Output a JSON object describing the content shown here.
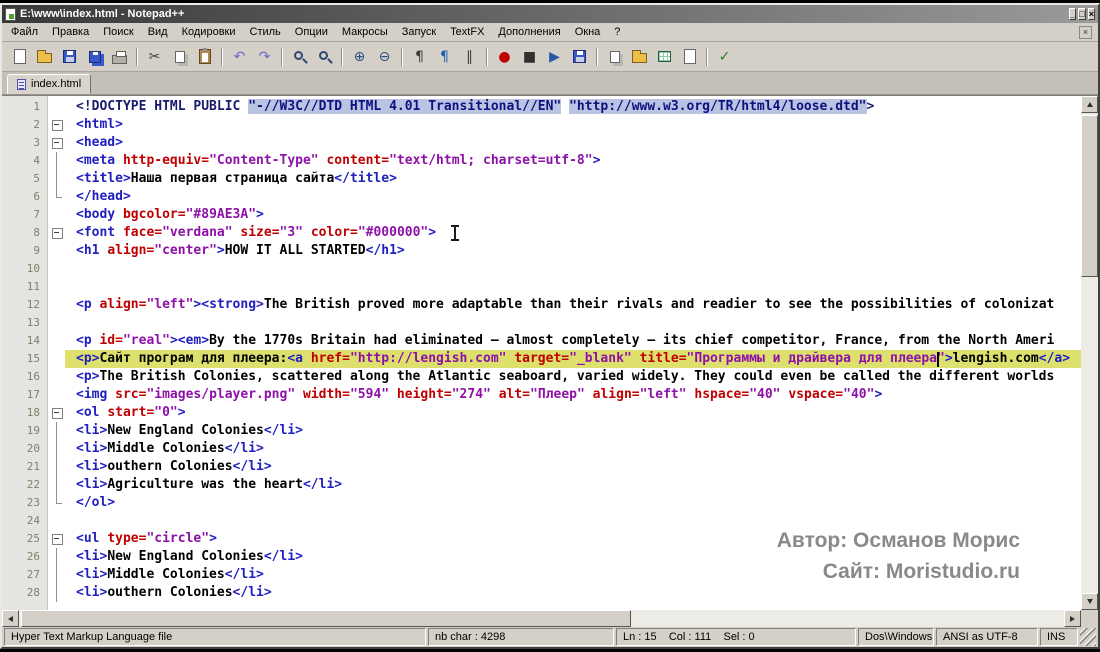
{
  "window": {
    "title": "E:\\www\\index.html - Notepad++",
    "controls": [
      {
        "name": "minimize",
        "glyph": "_"
      },
      {
        "name": "maximize",
        "glyph": "□"
      },
      {
        "name": "close",
        "glyph": "×"
      }
    ]
  },
  "menu": {
    "close_glyph": "×",
    "items": [
      {
        "name": "menu-file",
        "label": "Файл"
      },
      {
        "name": "menu-edit",
        "label": "Правка"
      },
      {
        "name": "menu-search",
        "label": "Поиск"
      },
      {
        "name": "menu-view",
        "label": "Вид"
      },
      {
        "name": "menu-encodings",
        "label": "Кодировки"
      },
      {
        "name": "menu-style",
        "label": "Стиль"
      },
      {
        "name": "menu-settings",
        "label": "Опции"
      },
      {
        "name": "menu-macros",
        "label": "Макросы"
      },
      {
        "name": "menu-run",
        "label": "Запуск"
      },
      {
        "name": "menu-textfx",
        "label": "TextFX"
      },
      {
        "name": "menu-plugins",
        "label": "Дополнения"
      },
      {
        "name": "menu-windows",
        "label": "Окна"
      },
      {
        "name": "menu-help",
        "label": "?"
      }
    ]
  },
  "toolbar": {
    "icons": [
      {
        "name": "new-file",
        "kind": "page"
      },
      {
        "name": "open-file",
        "kind": "folder"
      },
      {
        "name": "save",
        "kind": "floppy"
      },
      {
        "name": "save-all",
        "kind": "floppy2"
      },
      {
        "name": "print",
        "kind": "printer"
      },
      {
        "sep": true
      },
      {
        "name": "cut",
        "glyph": "✂",
        "color": "#404040"
      },
      {
        "name": "copy",
        "kind": "pages"
      },
      {
        "name": "paste",
        "kind": "clipboard"
      },
      {
        "sep": true
      },
      {
        "name": "undo",
        "glyph": "↶",
        "color": "#6868C8"
      },
      {
        "name": "redo",
        "glyph": "↷",
        "color": "#6868C8"
      },
      {
        "sep": true
      },
      {
        "name": "find",
        "kind": "mag"
      },
      {
        "name": "find-replace",
        "kind": "mag"
      },
      {
        "sep": true
      },
      {
        "name": "zoom-in",
        "glyph": "⊕",
        "color": "#305080"
      },
      {
        "name": "zoom-out",
        "glyph": "⊖",
        "color": "#305080"
      },
      {
        "sep": true
      },
      {
        "name": "word-wrap",
        "glyph": "¶",
        "color": "#404040"
      },
      {
        "name": "show-all-characters",
        "glyph": "¶",
        "color": "#2060A8"
      },
      {
        "name": "indent-guide",
        "glyph": "∥",
        "color": "#404040"
      },
      {
        "sep": true
      },
      {
        "name": "record-macro",
        "glyph": "●",
        "color": "#C00000"
      },
      {
        "name": "stop-macro",
        "glyph": "■",
        "color": "#303030"
      },
      {
        "name": "play-macro",
        "glyph": "▶",
        "color": "#2858A8"
      },
      {
        "name": "save-macro",
        "kind": "floppy"
      },
      {
        "sep": true
      },
      {
        "name": "doc-monitor",
        "kind": "pages"
      },
      {
        "name": "folder-workspace",
        "kind": "folder"
      },
      {
        "name": "function-list",
        "kind": "grid"
      },
      {
        "name": "doc-map",
        "kind": "page"
      },
      {
        "sep": true
      },
      {
        "name": "spell-check",
        "glyph": "✓",
        "color": "#208020"
      }
    ]
  },
  "tabs": [
    {
      "label": "index.html",
      "active": true
    }
  ],
  "editor": {
    "lines": [
      {
        "n": 1,
        "fold": "",
        "seg": [
          [
            "doc",
            "<!DOCTYPE HTML PUBLIC "
          ],
          [
            "docstr",
            "\"-//W3C//DTD HTML 4.01 Transitional//EN\""
          ],
          [
            "doc",
            " "
          ],
          [
            "docstr",
            "\"http://www.w3.org/TR/html4/loose.dtd\""
          ],
          [
            "doc",
            ">"
          ]
        ]
      },
      {
        "n": 2,
        "fold": "box",
        "seg": [
          [
            "tag",
            "<html>"
          ]
        ]
      },
      {
        "n": 3,
        "fold": "box",
        "seg": [
          [
            "tag",
            "<head>"
          ]
        ]
      },
      {
        "n": 4,
        "fold": "line",
        "seg": [
          [
            "tag",
            "<meta "
          ],
          [
            "attr",
            "http-equiv="
          ],
          [
            "val",
            "\"Content-Type\""
          ],
          [
            "attr",
            " content="
          ],
          [
            "val",
            "\"text/html; charset=utf-8\""
          ],
          [
            "tag",
            ">"
          ]
        ]
      },
      {
        "n": 5,
        "fold": "line",
        "seg": [
          [
            "tag",
            "<title>"
          ],
          [
            "txt",
            "Наша первая страница сайта"
          ],
          [
            "tag",
            "</title>"
          ]
        ]
      },
      {
        "n": 6,
        "fold": "end",
        "seg": [
          [
            "tag",
            "</head>"
          ]
        ]
      },
      {
        "n": 7,
        "fold": "",
        "seg": [
          [
            "tag",
            "<body "
          ],
          [
            "attr",
            "bgcolor="
          ],
          [
            "val",
            "\"#89AE3A\""
          ],
          [
            "tag",
            ">"
          ]
        ]
      },
      {
        "n": 8,
        "fold": "box",
        "seg": [
          [
            "tag",
            "<font "
          ],
          [
            "attr",
            "face="
          ],
          [
            "val",
            "\"verdana\""
          ],
          [
            "attr",
            " size="
          ],
          [
            "val",
            "\"3\""
          ],
          [
            "attr",
            " color="
          ],
          [
            "val",
            "\"#000000\""
          ],
          [
            "tag",
            ">"
          ]
        ]
      },
      {
        "n": 9,
        "fold": "",
        "seg": [
          [
            "tag",
            "<h1 "
          ],
          [
            "attr",
            "align="
          ],
          [
            "val",
            "\"center\""
          ],
          [
            "tag",
            ">"
          ],
          [
            "txt",
            "HOW IT ALL STARTED"
          ],
          [
            "tag",
            "</h1>"
          ]
        ]
      },
      {
        "n": 10,
        "fold": "",
        "seg": []
      },
      {
        "n": 11,
        "fold": "",
        "seg": []
      },
      {
        "n": 12,
        "fold": "",
        "seg": [
          [
            "tag",
            "<p "
          ],
          [
            "attr",
            "align="
          ],
          [
            "val",
            "\"left\""
          ],
          [
            "tag",
            "><strong>"
          ],
          [
            "txt",
            "The British proved more adaptable than their rivals and readier to see the possibilities of colonizat"
          ]
        ]
      },
      {
        "n": 13,
        "fold": "",
        "seg": []
      },
      {
        "n": 14,
        "fold": "",
        "seg": [
          [
            "tag",
            "<p "
          ],
          [
            "attr",
            "id="
          ],
          [
            "val",
            "\"real\""
          ],
          [
            "tag",
            "><em>"
          ],
          [
            "txt",
            "By the 1770s Britain had eliminated — almost completely — its chief competitor, France, from the North Ameri"
          ]
        ]
      },
      {
        "n": 15,
        "fold": "",
        "cur": true,
        "seg": [
          [
            "tag",
            "<p>"
          ],
          [
            "txt",
            "Сайт програм для плеера:"
          ],
          [
            "tag",
            "<a "
          ],
          [
            "attr",
            "href="
          ],
          [
            "val",
            "\"http://lengish.com\""
          ],
          [
            "attr",
            " target="
          ],
          [
            "val",
            "\"_blank\""
          ],
          [
            "attr",
            " title="
          ],
          [
            "val",
            "\"Программы и драйвера для плеера\""
          ],
          [
            "tag",
            ">"
          ],
          [
            "txt",
            "lengish.com"
          ],
          [
            "tag",
            "</a>"
          ]
        ]
      },
      {
        "n": 16,
        "fold": "",
        "seg": [
          [
            "tag",
            "<p>"
          ],
          [
            "txt",
            "The British Colonies, scattered along the Atlantic seaboard, varied widely. They could even be called the different worlds"
          ]
        ]
      },
      {
        "n": 17,
        "fold": "",
        "seg": [
          [
            "tag",
            "<img "
          ],
          [
            "attr",
            "src="
          ],
          [
            "val",
            "\"images/player.png\""
          ],
          [
            "attr",
            " width="
          ],
          [
            "val",
            "\"594\""
          ],
          [
            "attr",
            " height="
          ],
          [
            "val",
            "\"274\""
          ],
          [
            "attr",
            " alt="
          ],
          [
            "val",
            "\"Плеер\""
          ],
          [
            "attr",
            " align="
          ],
          [
            "val",
            "\"left\""
          ],
          [
            "attr",
            " hspace="
          ],
          [
            "val",
            "\"40\""
          ],
          [
            "attr",
            " vspace="
          ],
          [
            "val",
            "\"40\""
          ],
          [
            "tag",
            ">"
          ]
        ]
      },
      {
        "n": 18,
        "fold": "box",
        "seg": [
          [
            "tag",
            "<ol "
          ],
          [
            "attr",
            "start="
          ],
          [
            "val",
            "\"0\""
          ],
          [
            "tag",
            ">"
          ]
        ]
      },
      {
        "n": 19,
        "fold": "line",
        "seg": [
          [
            "tag",
            "<li>"
          ],
          [
            "txt",
            "New England Colonies"
          ],
          [
            "tag",
            "</li>"
          ]
        ]
      },
      {
        "n": 20,
        "fold": "line",
        "seg": [
          [
            "tag",
            "<li>"
          ],
          [
            "txt",
            "Middle Colonies"
          ],
          [
            "tag",
            "</li>"
          ]
        ]
      },
      {
        "n": 21,
        "fold": "line",
        "seg": [
          [
            "tag",
            "<li>"
          ],
          [
            "txt",
            "outhern Colonies"
          ],
          [
            "tag",
            "</li>"
          ]
        ]
      },
      {
        "n": 22,
        "fold": "line",
        "seg": [
          [
            "tag",
            "<li>"
          ],
          [
            "txt",
            "Agriculture was the heart"
          ],
          [
            "tag",
            "</li>"
          ]
        ]
      },
      {
        "n": 23,
        "fold": "end",
        "seg": [
          [
            "tag",
            "</ol>"
          ]
        ]
      },
      {
        "n": 24,
        "fold": "",
        "seg": []
      },
      {
        "n": 25,
        "fold": "box",
        "seg": [
          [
            "tag",
            "<ul "
          ],
          [
            "attr",
            "type="
          ],
          [
            "val",
            "\"circle\""
          ],
          [
            "tag",
            ">"
          ]
        ]
      },
      {
        "n": 26,
        "fold": "line",
        "seg": [
          [
            "tag",
            "<li>"
          ],
          [
            "txt",
            "New England Colonies"
          ],
          [
            "tag",
            "</li>"
          ]
        ]
      },
      {
        "n": 27,
        "fold": "line",
        "seg": [
          [
            "tag",
            "<li>"
          ],
          [
            "txt",
            "Middle Colonies"
          ],
          [
            "tag",
            "</li>"
          ]
        ]
      },
      {
        "n": 28,
        "fold": "line",
        "seg": [
          [
            "tag",
            "<li>"
          ],
          [
            "txt",
            "outhern Colonies"
          ],
          [
            "tag",
            "</li>"
          ]
        ]
      }
    ]
  },
  "watermark": {
    "line1": "Автор: Османов Морис",
    "line2": "Сайт: Moristudio.ru"
  },
  "statusbar": {
    "cells": [
      {
        "name": "status-file-type",
        "cls": "sb-c1",
        "text": "Hyper Text Markup Language file"
      },
      {
        "name": "status-char-count",
        "cls": "sb-c2",
        "text": "nb char : 4298"
      },
      {
        "name": "status-cursor-position",
        "cls": "sb-c3",
        "text": "Ln : 15    Col : 111    Sel : 0"
      },
      {
        "name": "status-eol-format",
        "cls": "sb-c4",
        "text": "Dos\\Windows"
      },
      {
        "name": "status-encoding",
        "cls": "sb-c5",
        "text": "ANSI as UTF-8"
      },
      {
        "name": "status-typing-mode",
        "cls": "sb-c6",
        "text": "INS"
      }
    ]
  }
}
